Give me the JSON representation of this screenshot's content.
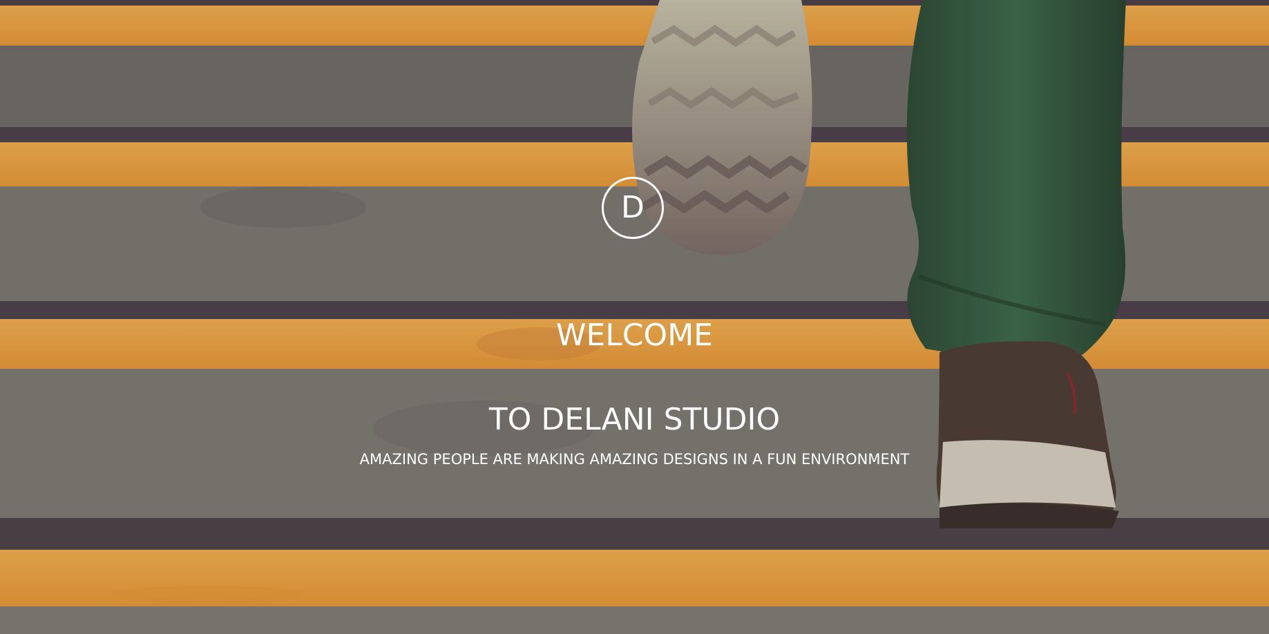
{
  "hero": {
    "logo_letter": "D",
    "welcome": "WELCOME",
    "studio_name": "TO DELANI STUDIO",
    "tagline": "AMAZING PEOPLE ARE MAKING AMAZING DESIGNS IN A FUN ENVIRONMENT"
  },
  "colors": {
    "stripe_orange": "#f2a640",
    "step_gray": "#77766e",
    "text": "#ffffff",
    "pants_green": "#2f5a3b"
  },
  "background": {
    "subject": "stair-steps-photo",
    "icon": "stairs-with-walking-feet"
  }
}
